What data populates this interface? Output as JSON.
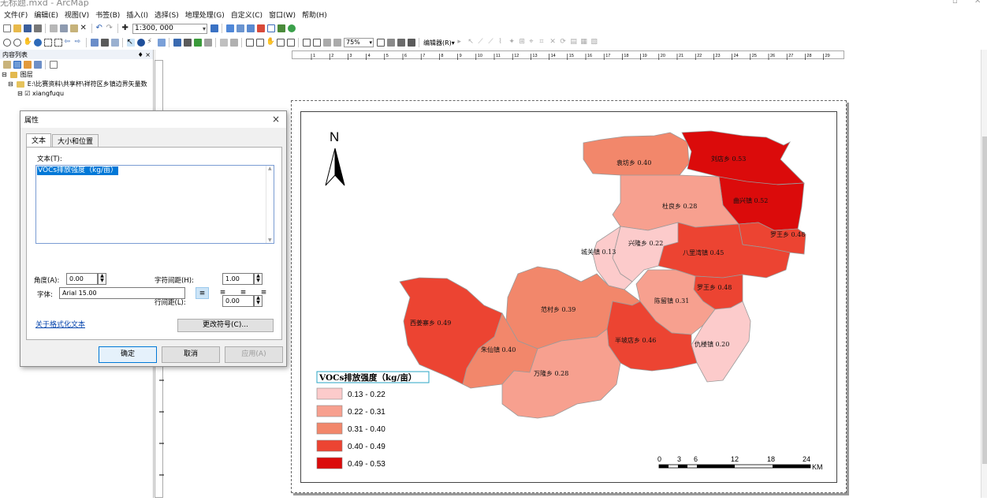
{
  "window": {
    "title": "无标题.mxd - ArcMap"
  },
  "menu": [
    "文件(F)",
    "编辑(E)",
    "视图(V)",
    "书签(B)",
    "插入(I)",
    "选择(S)",
    "地理处理(G)",
    "自定义(C)",
    "窗口(W)",
    "帮助(H)"
  ],
  "toolbar": {
    "scale": "1:300, 000",
    "zoom": "75%",
    "editor": "编辑器(R)▾"
  },
  "toc": {
    "title": "内容列表",
    "pin": "♦ ×",
    "tree": {
      "layers": "图层",
      "folder": "E:\\比赛资料\\共享杯\\祥符区乡镇边界矢量数",
      "layer": "xiangfuqu"
    }
  },
  "dialog": {
    "title": "属性",
    "close": "×",
    "tabs": [
      "文本",
      "大小和位置"
    ],
    "text_label": "文本(T):",
    "text_value": "VOCs排放强度（kg/亩）",
    "font_label": "字体:",
    "font_value": "Arial 15.00",
    "align_icons": [
      "≡",
      "≡",
      "≡",
      "≡"
    ],
    "angle_label": "角度(A):",
    "angle_value": "0.00",
    "char_spacing_label": "字符间距(H):",
    "char_spacing_value": "1.00",
    "line_spacing_label": "行间距(L):",
    "line_spacing_value": "0.00",
    "format_link": "关于格式化文本",
    "change_symbol": "更改符号(C)...",
    "ok": "确定",
    "cancel": "取消",
    "apply": "应用(A)"
  },
  "map": {
    "north": "N",
    "regions": [
      {
        "name": "袁坊乡 0.40",
        "color": "#f2876b"
      },
      {
        "name": "刘店乡 0.53",
        "color": "#db0b0b"
      },
      {
        "name": "杜良乡 0.28",
        "color": "#f7a08f"
      },
      {
        "name": "西姜寨乡 0.49",
        "color": "#ec4432"
      },
      {
        "name": "朱仙镇 0.40",
        "color": "#f2876b"
      },
      {
        "name": "万隆乡 0.28",
        "color": "#f7a08f"
      },
      {
        "name": "范村乡 0.39",
        "color": "#f2876b"
      },
      {
        "name": "半坡店乡 0.46",
        "color": "#ec4432"
      },
      {
        "name": "陈留镇 0.31",
        "color": "#f7a08f"
      },
      {
        "name": "仇楼镇 0.20",
        "color": "#fccbcb"
      },
      {
        "name": "曲兴镇 0.52",
        "color": "#db0b0b"
      },
      {
        "name": "罗王乡 0.48",
        "color": "#ec4432"
      },
      {
        "name": "兴隆乡 0.22",
        "color": "#fccbcb"
      },
      {
        "name": "城关镇 0.13",
        "color": "#fccbcb"
      },
      {
        "name": "八里湾镇 0.45",
        "color": "#ec4432"
      },
      {
        "name": "罗王乡 0.48",
        "color": "#ec4432"
      }
    ],
    "legend": {
      "title": "VOCs排放强度（kg/亩）",
      "classes": [
        {
          "label": "0.13 - 0.22",
          "color": "#fccbcb"
        },
        {
          "label": "0.22 - 0.31",
          "color": "#f7a08f"
        },
        {
          "label": "0.31 - 0.40",
          "color": "#f2876b"
        },
        {
          "label": "0.40 - 0.49",
          "color": "#ec4432"
        },
        {
          "label": "0.49 - 0.53",
          "color": "#db0b0b"
        }
      ]
    },
    "scalebar": {
      "ticks": [
        "0",
        "3",
        "6",
        "12",
        "18",
        "24"
      ],
      "unit": "KM"
    }
  },
  "ruler_labels": [
    "1",
    "2",
    "3",
    "4",
    "5",
    "6",
    "7",
    "8",
    "9",
    "10",
    "11",
    "12",
    "13",
    "14",
    "15",
    "16",
    "17",
    "18",
    "19",
    "20",
    "21",
    "22",
    "23",
    "24",
    "25",
    "26",
    "27",
    "28",
    "29"
  ]
}
